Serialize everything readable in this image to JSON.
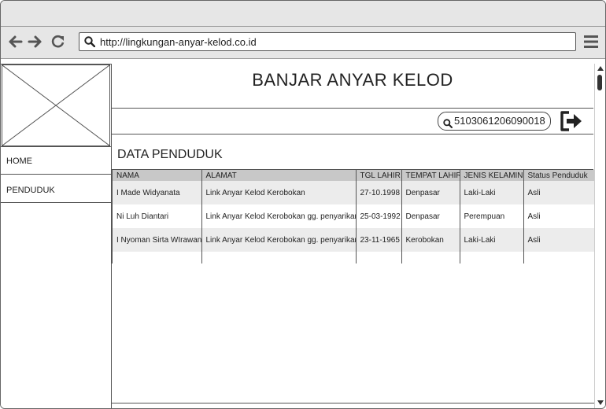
{
  "browser": {
    "url": "http://lingkungan-anyar-kelod.co.id",
    "icons": [
      "back-arrow-icon",
      "forward-arrow-icon",
      "reload-icon",
      "search-icon",
      "hamburger-menu-icon"
    ]
  },
  "sidebar": {
    "items": [
      {
        "label": "HOME"
      },
      {
        "label": "PENDUDUK"
      }
    ]
  },
  "header": {
    "title": "BANJAR ANYAR KELOD"
  },
  "toolbar": {
    "nik": "5103061206090018",
    "icons": [
      "search-icon",
      "logout-icon"
    ]
  },
  "main": {
    "section_title": "DATA PENDUDUK",
    "table": {
      "columns": [
        "NAMA",
        "ALAMAT",
        "TGL LAHIR",
        "TEMPAT LAHIR",
        "JENIS KELAMIN",
        "Status Penduduk"
      ],
      "rows": [
        [
          "I Made Widyanata",
          "Link Anyar Kelod Kerobokan",
          "27-10.1998",
          "Denpasar",
          "Laki-Laki",
          "Asli"
        ],
        [
          "Ni Luh Diantari",
          "Link Anyar Kelod Kerobokan gg. penyarikan",
          "25-03-1992",
          "Denpasar",
          "Perempuan",
          "Asli"
        ],
        [
          "I Nyoman Sirta WIrawan",
          "Link Anyar Kelod Kerobokan gg. penyarikan",
          "23-11-1965",
          "Kerobokan",
          "Laki-Laki",
          "Asli"
        ]
      ]
    }
  },
  "colors": {
    "header_row": "#c8c8c8",
    "stripe_row": "#ececec",
    "chrome": "#e6e6e6",
    "border": "#555555"
  }
}
